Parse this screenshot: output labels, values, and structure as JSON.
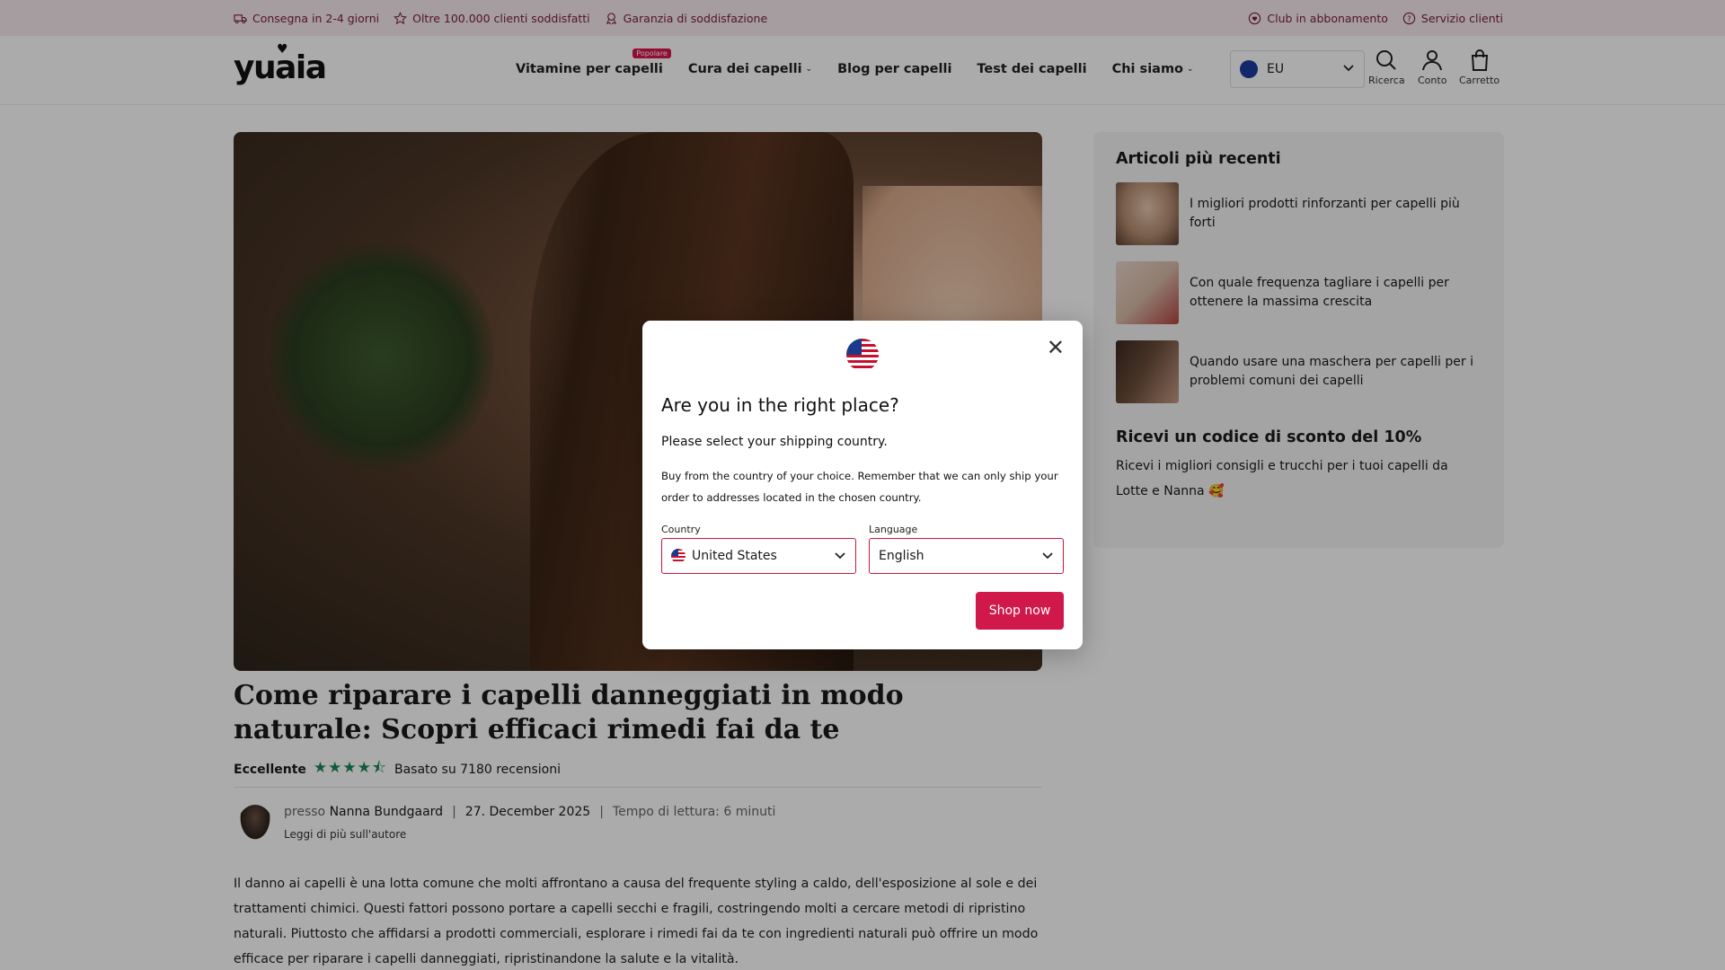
{
  "topbar": {
    "delivery": "Consegna in 2-4 giorni",
    "customers": "Oltre 100.000 clienti soddisfatti",
    "guarantee": "Garanzia di soddisfazione",
    "club": "Club in abbonamento",
    "service": "Servizio clienti"
  },
  "header": {
    "logo": "yuaia",
    "nav": {
      "vitamins": "Vitamine per capelli",
      "vitamins_badge": "Popolare",
      "care": "Cura dei capelli",
      "blog": "Blog per capelli",
      "test": "Test dei capelli",
      "about": "Chi siamo"
    },
    "region": "EU",
    "search": "Ricerca",
    "account": "Conto",
    "cart": "Carretto"
  },
  "article": {
    "title": "Come riparare i capelli danneggiati in modo naturale: Scopri efficaci rimedi fai da te",
    "rating_label": "Eccellente",
    "rating_value": 4.5,
    "reviews": "Basato su 7180 recensioni",
    "author_prefix": "presso",
    "author": "Nanna Bundgaard",
    "date": "27. December 2025",
    "reading_time": "Tempo di lettura: 6 minuti",
    "author_link": "Leggi di più sull'autore",
    "body": "Il danno ai capelli è una lotta comune che molti affrontano a causa del frequente styling a caldo, dell'esposizione al sole e dei trattamenti chimici. Questi fattori possono portare a capelli secchi e fragili, costringendo molti a cercare metodi di ripristino naturali. Piuttosto che affidarsi a prodotti commerciali, esplorare i rimedi fai da te con ingredienti naturali può offrire un modo efficace per riparare i capelli danneggiati, ripristinandone la salute e la vitalità."
  },
  "sidebar": {
    "recent_title": "Articoli più recenti",
    "articles": [
      {
        "title": "I migliori prodotti rinforzanti per capelli più forti"
      },
      {
        "title": "Con quale frequenza tagliare i capelli per ottenere la massima crescita"
      },
      {
        "title": "Quando usare una maschera per capelli per i problemi comuni dei capelli"
      }
    ],
    "discount_title": "Ricevi un codice di sconto del 10%",
    "discount_text": "Ricevi i migliori consigli e trucchi per i tuoi capelli da Lotte e Nanna 🥰"
  },
  "modal": {
    "title": "Are you in the right place?",
    "subtitle": "Please select your shipping country.",
    "description": "Buy from the country of your choice. Remember that we can only ship your order to addresses located in the chosen country.",
    "country_label": "Country",
    "country_value": "United States",
    "language_label": "Language",
    "language_value": "English",
    "shop_button": "Shop now",
    "close": "✕"
  },
  "colors": {
    "accent": "#d0184a",
    "topbar_bg": "#f6eaef",
    "star": "#1a8a54"
  }
}
